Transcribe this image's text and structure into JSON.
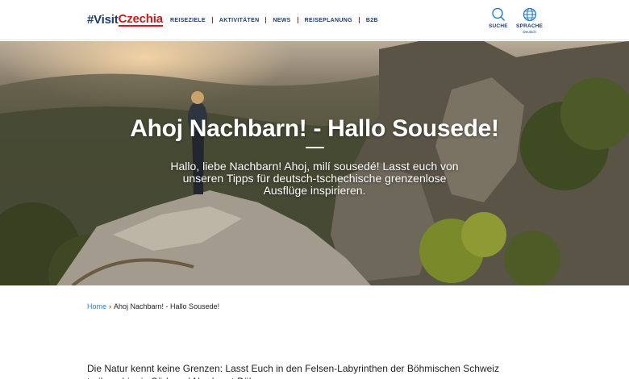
{
  "header": {
    "logo_hash": "#Visit",
    "logo_brand": "Czechia",
    "nav": [
      {
        "label": "REISEZIELE"
      },
      {
        "label": "AKTIVITÄTEN"
      },
      {
        "label": "NEWS"
      },
      {
        "label": "REISEPLANUNG"
      },
      {
        "label": "B2B"
      }
    ],
    "search_label": "SUCHE",
    "language_label": "SPRACHE",
    "language_current": "Deutsch"
  },
  "hero": {
    "title": "Ahoj Nachbarn! - Hallo Sousede!",
    "subtitle": "Hallo, liebe Nachbarn! Ahoj, milí sousedé! Lasst euch von unseren Tipps für deutsch-tschechische grenzenlose Ausflüge inspirieren."
  },
  "breadcrumb": {
    "home": "Home",
    "separator": "›",
    "current": "Ahoj Nachbarn! - Hallo Sousede!"
  },
  "intro": {
    "line1": "Die Natur kennt keine Grenzen: Lasst Euch in den Felsen-Labyrinthen der Böhmischen Schweiz",
    "line2": "treiben, hier in Süd- und Nordwest-Böhmen ..."
  },
  "colors": {
    "brand_navy": "#1c3d6e",
    "brand_red": "#d7141a",
    "link_blue": "#2a7fc8"
  },
  "icons": {
    "search": "search-icon",
    "language": "globe-icon"
  }
}
